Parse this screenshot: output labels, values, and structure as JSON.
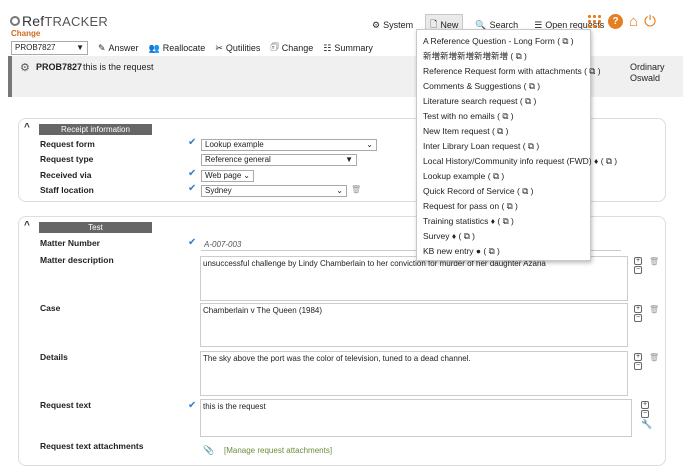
{
  "app": {
    "logo_ref": "Ref",
    "logo_tracker": "TRACKER",
    "subtitle": "Change"
  },
  "nav": {
    "system": "System",
    "new": "New",
    "search": "Search",
    "open_requests": "Open requests"
  },
  "toolbar": {
    "prob_select": "PROB7827",
    "answer": "Answer",
    "reallocate": "Reallocate",
    "qutilities": "Qutilities",
    "change": "Change",
    "summary": "Summary"
  },
  "banner": {
    "number": "PROB7827",
    "title": "this is the request",
    "user_line1": "Ordinary",
    "user_line2": "Oswald"
  },
  "receipt": {
    "title": "Receipt information",
    "request_form_label": "Request form",
    "request_form_value": "Lookup example",
    "request_type_label": "Request type",
    "request_type_value": "Reference general",
    "received_via_label": "Received via",
    "received_via_value": "Web page",
    "staff_location_label": "Staff location",
    "staff_location_value": "Sydney"
  },
  "test": {
    "title": "Test",
    "matter_number_label": "Matter Number",
    "matter_number_value": "A-007-003",
    "matter_description_label": "Matter description",
    "matter_description_value": "unsuccessful challenge by Lindy Chamberlain to her conviction for murder of her daughter Azaria",
    "case_label": "Case",
    "case_value": "Chamberlain v The Queen (1984)",
    "details_label": "Details",
    "details_value": "The sky above the port was the color of television, tuned to a dead channel.",
    "request_text_label": "Request text",
    "request_text_value": "this is the request",
    "attachments_label": "Request text attachments",
    "attachments_link": "[Manage request attachments]"
  },
  "new_menu": [
    "A Reference Question - Long Form",
    "新増新増新増新増新増",
    "Reference Request form with attachments",
    "Comments & Suggestions",
    "Literature search request",
    "Test with no emails",
    "New Item request",
    "Inter Library Loan request",
    "Local History/Community info request (FWD) ♦",
    "Lookup example",
    "Quick Record of Service",
    "Request for pass on",
    "Training statistics ♦",
    "Survey ♦",
    "KB new entry ●"
  ],
  "colors": {
    "accent": "#e67e22",
    "check": "#2f7fd0",
    "panel_title": "#666666",
    "link": "#6a8f3a"
  }
}
